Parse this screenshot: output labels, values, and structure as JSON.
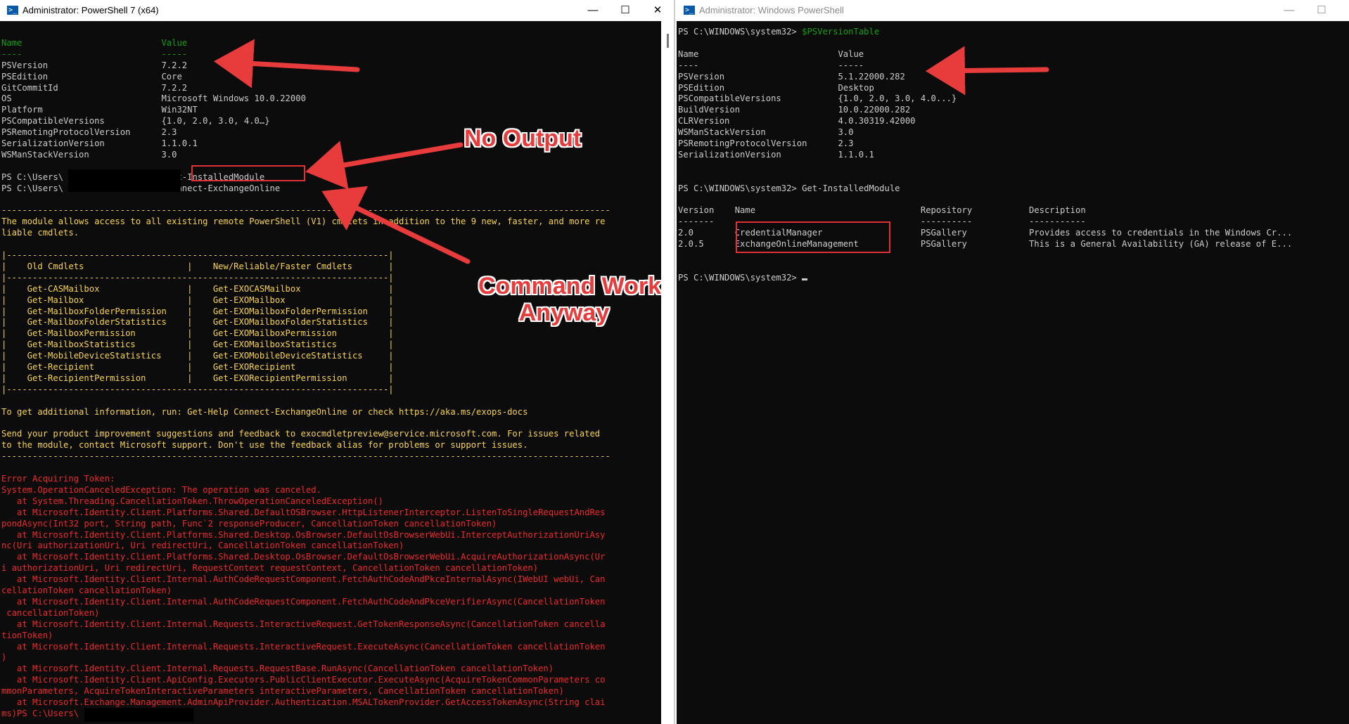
{
  "left_window": {
    "title": "Administrator: PowerShell 7 (x64)",
    "controls": {
      "minimize": "—",
      "maximize": "☐",
      "close": "✕"
    },
    "lines": [
      "",
      "Name                           Value",
      "----                           -----",
      "PSVersion                      7.2.2",
      "PSEdition                      Core",
      "GitCommitId                    7.2.2",
      "OS                             Microsoft Windows 10.0.22000",
      "Platform                       Win32NT",
      "PSCompatibleVersions           {1.0, 2.0, 3.0, 4.0…}",
      "PSRemotingProtocolVersion      2.3",
      "SerializationVersion           1.1.0.1",
      "WSManStackVersion              3.0",
      "",
      "PS C:\\Users\\                  > Get-InstalledModule",
      "PS C:\\Users\\                  > Connect-ExchangeOnline",
      "",
      "----------------------------------------------------------------------------------------------------------------------",
      "The module allows access to all existing remote PowerShell (V1) cmdlets in addition to the 9 new, faster, and more re",
      "liable cmdlets.",
      "",
      "|--------------------------------------------------------------------------|",
      "|    Old Cmdlets                    |    New/Reliable/Faster Cmdlets       |",
      "|--------------------------------------------------------------------------|",
      "|    Get-CASMailbox                 |    Get-EXOCASMailbox                 |",
      "|    Get-Mailbox                    |    Get-EXOMailbox                    |",
      "|    Get-MailboxFolderPermission    |    Get-EXOMailboxFolderPermission    |",
      "|    Get-MailboxFolderStatistics    |    Get-EXOMailboxFolderStatistics    |",
      "|    Get-MailboxPermission          |    Get-EXOMailboxPermission          |",
      "|    Get-MailboxStatistics          |    Get-EXOMailboxStatistics          |",
      "|    Get-MobileDeviceStatistics     |    Get-EXOMobileDeviceStatistics     |",
      "|    Get-Recipient                  |    Get-EXORecipient                  |",
      "|    Get-RecipientPermission        |    Get-EXORecipientPermission        |",
      "|--------------------------------------------------------------------------|",
      "",
      "To get additional information, run: Get-Help Connect-ExchangeOnline or check https://aka.ms/exops-docs",
      "",
      "Send your product improvement suggestions and feedback to exocmdletpreview@service.microsoft.com. For issues related",
      "to the module, contact Microsoft support. Don't use the feedback alias for problems or support issues.",
      "----------------------------------------------------------------------------------------------------------------------",
      "",
      "Error Acquiring Token:",
      "System.OperationCanceledException: The operation was canceled.",
      "   at System.Threading.CancellationToken.ThrowOperationCanceledException()",
      "   at Microsoft.Identity.Client.Platforms.Shared.DefaultOSBrowser.HttpListenerInterceptor.ListenToSingleRequestAndRes",
      "pondAsync(Int32 port, String path, Func`2 responseProducer, CancellationToken cancellationToken)",
      "   at Microsoft.Identity.Client.Platforms.Shared.Desktop.OsBrowser.DefaultOsBrowserWebUi.InterceptAuthorizationUriAsy",
      "nc(Uri authorizationUri, Uri redirectUri, CancellationToken cancellationToken)",
      "   at Microsoft.Identity.Client.Platforms.Shared.Desktop.OsBrowser.DefaultOsBrowserWebUi.AcquireAuthorizationAsync(Ur",
      "i authorizationUri, Uri redirectUri, RequestContext requestContext, CancellationToken cancellationToken)",
      "   at Microsoft.Identity.Client.Internal.AuthCodeRequestComponent.FetchAuthCodeAndPkceInternalAsync(IWebUI webUi, Can",
      "cellationToken cancellationToken)",
      "   at Microsoft.Identity.Client.Internal.AuthCodeRequestComponent.FetchAuthCodeAndPkceVerifierAsync(CancellationToken",
      " cancellationToken)",
      "   at Microsoft.Identity.Client.Internal.Requests.InteractiveRequest.GetTokenResponseAsync(CancellationToken cancella",
      "tionToken)",
      "   at Microsoft.Identity.Client.Internal.Requests.InteractiveRequest.ExecuteAsync(CancellationToken cancellationToken",
      ")",
      "   at Microsoft.Identity.Client.Internal.Requests.RequestBase.RunAsync(CancellationToken cancellationToken)",
      "   at Microsoft.Identity.Client.ApiConfig.Executors.PublicClientExecutor.ExecuteAsync(AcquireTokenCommonParameters co",
      "mmonParameters, AcquireTokenInteractiveParameters interactiveParameters, CancellationToken cancellationToken)",
      "   at Microsoft.Exchange.Management.AdminApiProvider.Authentication.MSALTokenProvider.GetAccessTokenAsync(String clai",
      "ms)PS C:\\Users\\                  >"
    ]
  },
  "right_window": {
    "title": "Administrator: Windows PowerShell",
    "controls": {
      "minimize": "—",
      "maximize": "☐"
    },
    "lines": [
      "PS C:\\WINDOWS\\system32> $PSVersionTable",
      "",
      "Name                           Value",
      "----                           -----",
      "PSVersion                      5.1.22000.282",
      "PSEdition                      Desktop",
      "PSCompatibleVersions           {1.0, 2.0, 3.0, 4.0...}",
      "BuildVersion                   10.0.22000.282",
      "CLRVersion                     4.0.30319.42000",
      "WSManStackVersion              3.0",
      "PSRemotingProtocolVersion      2.3",
      "SerializationVersion           1.1.0.1",
      "",
      "",
      "PS C:\\WINDOWS\\system32> Get-InstalledModule",
      "",
      "Version    Name                                Repository           Description",
      "-------    ----                                ----------           -----------",
      "2.0        CredentialManager                   PSGallery            Provides access to credentials in the Windows Cr...",
      "2.0.5      ExchangeOnlineManagement            PSGallery            This is a General Availability (GA) release of E...",
      "",
      "",
      "PS C:\\WINDOWS\\system32> "
    ]
  },
  "annotations": {
    "no_output": "No Output",
    "command_work_line1": "Command Work",
    "command_work_line2": "Anyway"
  },
  "colors": {
    "terminal_bg": "#0c0c0c",
    "terminal_fg": "#cccccc",
    "header_green": "#13a10e",
    "input_yellow": "#f9f1a5",
    "warning_yellow": "#f9d44a",
    "error_red": "#ef2929",
    "annotation_red": "#e83b3b"
  }
}
